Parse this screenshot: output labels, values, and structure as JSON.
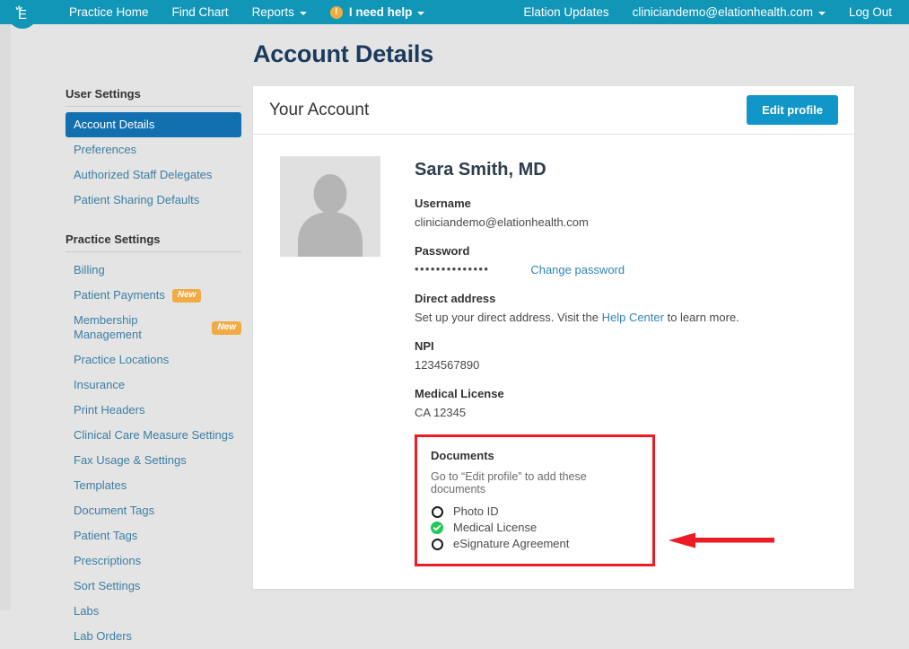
{
  "topnav": {
    "logo_alt": "elation-logo",
    "left_items": [
      {
        "label": "Practice Home",
        "has_caret": false
      },
      {
        "label": "Find Chart",
        "has_caret": false
      },
      {
        "label": "Reports",
        "has_caret": true
      }
    ],
    "help": {
      "icon": "!",
      "label": "I need help",
      "has_caret": true
    },
    "right_items": [
      {
        "label": "Elation Updates",
        "has_caret": false
      },
      {
        "label": "cliniciandemo@elationhealth.com",
        "has_caret": true
      },
      {
        "label": "Log Out",
        "has_caret": false
      }
    ],
    "background_color": "#1296b8"
  },
  "sidebar": {
    "groups": [
      {
        "title": "User Settings",
        "items": [
          {
            "label": "Account Details",
            "active": true,
            "badge": null
          },
          {
            "label": "Preferences",
            "active": false,
            "badge": null
          },
          {
            "label": "Authorized Staff Delegates",
            "active": false,
            "badge": null
          },
          {
            "label": "Patient Sharing Defaults",
            "active": false,
            "badge": null
          }
        ]
      },
      {
        "title": "Practice Settings",
        "items": [
          {
            "label": "Billing",
            "active": false,
            "badge": null
          },
          {
            "label": "Patient Payments",
            "active": false,
            "badge": "New"
          },
          {
            "label": "Membership Management",
            "active": false,
            "badge": "New"
          },
          {
            "label": "Practice Locations",
            "active": false,
            "badge": null
          },
          {
            "label": "Insurance",
            "active": false,
            "badge": null
          },
          {
            "label": "Print Headers",
            "active": false,
            "badge": null
          },
          {
            "label": "Clinical Care Measure Settings",
            "active": false,
            "badge": null
          },
          {
            "label": "Fax Usage & Settings",
            "active": false,
            "badge": null
          },
          {
            "label": "Templates",
            "active": false,
            "badge": null
          },
          {
            "label": "Document Tags",
            "active": false,
            "badge": null
          },
          {
            "label": "Patient Tags",
            "active": false,
            "badge": null
          },
          {
            "label": "Prescriptions",
            "active": false,
            "badge": null
          },
          {
            "label": "Sort Settings",
            "active": false,
            "badge": null
          },
          {
            "label": "Labs",
            "active": false,
            "badge": null
          },
          {
            "label": "Lab Orders",
            "active": false,
            "badge": null
          }
        ]
      }
    ],
    "active_color": "#1270b0",
    "link_color": "#3c7ea3",
    "badge_color": "#f2ab44"
  },
  "main": {
    "page_title": "Account Details",
    "card": {
      "title": "Your Account",
      "edit_button": "Edit profile",
      "button_color": "#1196c9",
      "avatar_name": "avatar-placeholder",
      "person_name": "Sara Smith, MD",
      "fields": {
        "username_label": "Username",
        "username_value": "cliniciandemo@elationhealth.com",
        "password_label": "Password",
        "password_masked": "••••••••••••••",
        "change_password_link": "Change password",
        "direct_address_label": "Direct address",
        "direct_address_text_before": "Set up your direct address. Visit the ",
        "direct_address_link": "Help Center",
        "direct_address_text_after": " to learn more.",
        "npi_label": "NPI",
        "npi_value": "1234567890",
        "medical_license_label": "Medical License",
        "medical_license_value": "CA 12345"
      },
      "documents": {
        "heading": "Documents",
        "hint": "Go to “Edit profile” to add these documents",
        "items": [
          {
            "label": "Photo ID",
            "status": "incomplete",
            "icon": "empty-circle-icon"
          },
          {
            "label": "Medical License",
            "status": "complete",
            "icon": "green-check-circle-icon"
          },
          {
            "label": "eSignature Agreement",
            "status": "incomplete",
            "icon": "empty-circle-icon"
          }
        ],
        "highlight_color": "#ed1c24",
        "complete_color": "#21ca55"
      }
    }
  },
  "annotation": {
    "arrow_color": "#ed1c24",
    "arrow_direction": "left",
    "points_to": "documents-block"
  }
}
